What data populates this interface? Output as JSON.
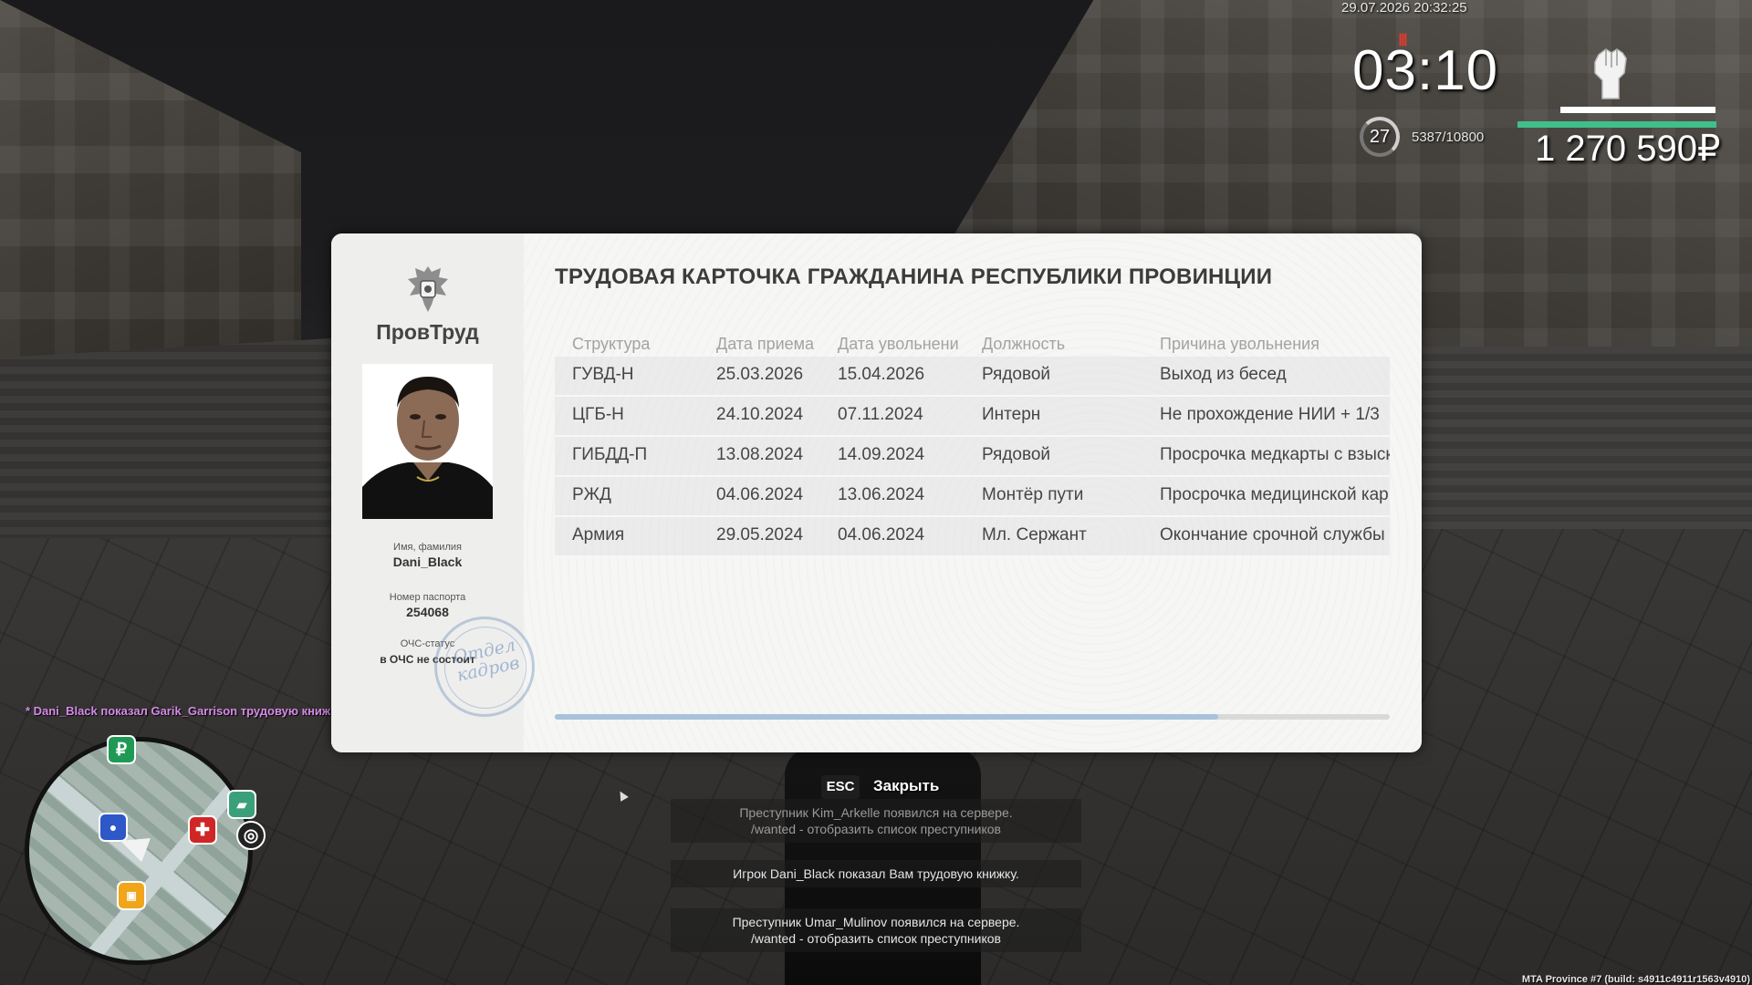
{
  "hud": {
    "datetime": "29.07.2026 20:32:25",
    "clock": "03:10",
    "level": "27",
    "experience": "5387/10800",
    "money": "1 270 590₽"
  },
  "card": {
    "brand": "ПровТруд",
    "title": "ТРУДОВАЯ КАРТОЧКА ГРАЖДАНИНА РЕСПУБЛИКИ ПРОВИНЦИИ",
    "name_label": "Имя, фамилия",
    "name_value": "Dani_Black",
    "passport_label": "Номер паспорта",
    "passport_value": "254068",
    "ochs_label": "ОЧС-статус",
    "ochs_value": "в ОЧС не состоит",
    "stamp_lines": [
      "Отдел",
      "кадров"
    ],
    "scroll_fraction": 0.795,
    "columns": [
      "Структура",
      "Дата приема",
      "Дата увольнени",
      "Должность",
      "Причина увольнения"
    ],
    "rows": [
      [
        "ГУВД-Н",
        "25.03.2026",
        "15.04.2026",
        "Рядовой",
        "Выход из бесед"
      ],
      [
        "ЦГБ-Н",
        "24.10.2024",
        "07.11.2024",
        "Интерн",
        "Не прохождение НИИ + 1/3"
      ],
      [
        "ГИБДД-П",
        "13.08.2024",
        "14.09.2024",
        "Рядовой",
        "Просрочка медкарты с взыск"
      ],
      [
        "РЖД",
        "04.06.2024",
        "13.06.2024",
        "Монтёр пути",
        "Просрочка медицинской кар"
      ],
      [
        "Армия",
        "29.05.2024",
        "04.06.2024",
        "Мл. Сержант",
        "Окончание срочной службы"
      ]
    ]
  },
  "close_hint": {
    "key": "ESC",
    "label": "Закрыть"
  },
  "chat": {
    "line": "* Dani_Black показал Garik_Garrison трудовую книжку"
  },
  "notifications": [
    {
      "line1": "Преступник Kim_Arkelle появился на сервере.",
      "line2": "/wanted - отобразить список преступников"
    },
    {
      "line1": "Игрок Dani_Black показал Вам трудовую книжку.",
      "line2": ""
    },
    {
      "line1": "Преступник Umar_Mulinov появился на сервере.",
      "line2": "/wanted - отобразить список преступников"
    }
  ],
  "minimap": {
    "icons": [
      "ruble-icon",
      "taxi-icon",
      "police-icon",
      "hospital-icon",
      "target-icon",
      "cab-icon"
    ],
    "ruble_symbol": "₽",
    "hospital_symbol": "✚",
    "target_symbol": "◎"
  },
  "build_info": "MTA Province #7 (build: s4911c4911r1563v4910)",
  "colors": {
    "money_bar": "#3fbf8a",
    "chat": "#d58ae8",
    "hunger": "#e23b2e"
  }
}
